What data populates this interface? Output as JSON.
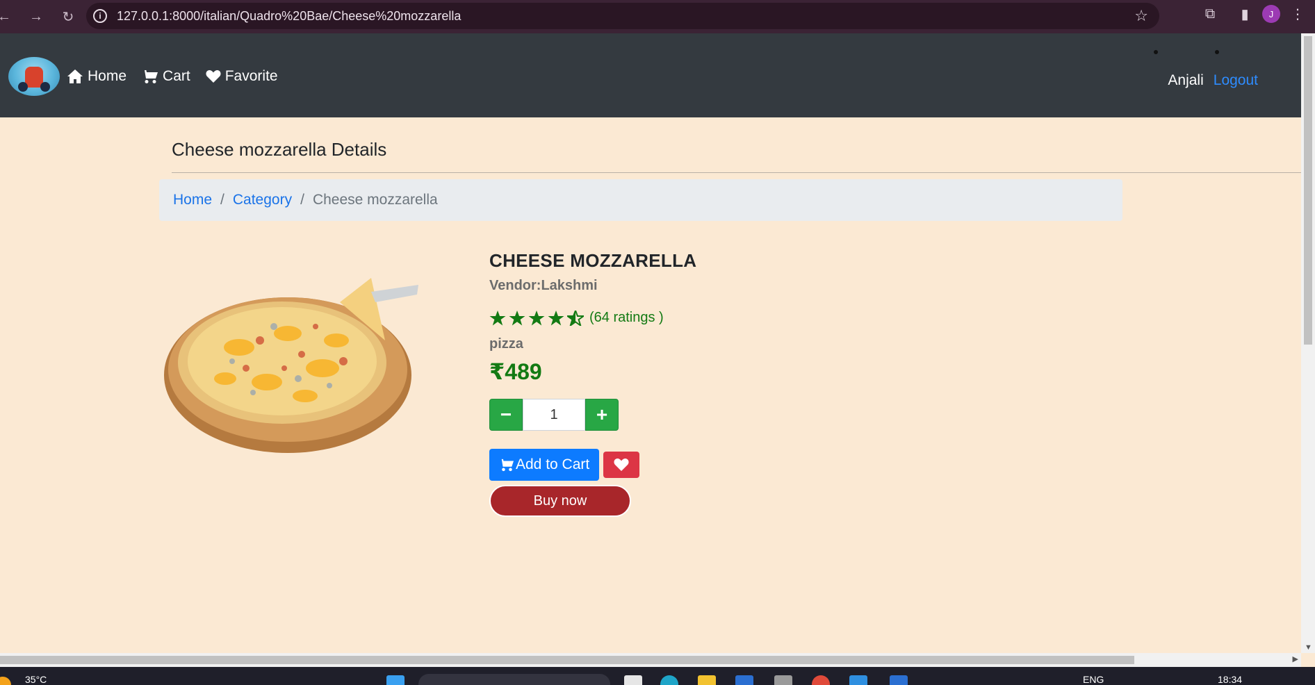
{
  "browser": {
    "url": "127.0.0.1:8000/italian/Quadro%20Bae/Cheese%20mozzarella",
    "profile_initial": "J"
  },
  "navbar": {
    "links": [
      {
        "label": "Home",
        "icon": "home-icon"
      },
      {
        "label": "Cart",
        "icon": "cart-icon"
      },
      {
        "label": "Favorite",
        "icon": "heart-icon"
      }
    ],
    "user_name": "Anjali",
    "logout_label": "Logout"
  },
  "page": {
    "title": "Cheese mozzarella Details",
    "breadcrumb": [
      "Home",
      "Category",
      "Cheese mozzarella"
    ]
  },
  "product": {
    "name": "CHEESE MOZZARELLA",
    "vendor": "Vendor:Lakshmi",
    "rating_stars": 4.5,
    "rating_text": "(64 ratings )",
    "category": "pizza",
    "price": "₹489",
    "quantity": "1",
    "add_to_cart_label": "Add to Cart",
    "buy_now_label": "Buy now"
  },
  "taskbar": {
    "temperature": "35°C",
    "language": "ENG",
    "time": "18:34"
  },
  "colors": {
    "page_bg": "#fbe9d3",
    "navbar_bg": "#343a40",
    "price_green": "#137a13",
    "primary_blue": "#0d7bff",
    "danger_red": "#dc3545",
    "buy_red": "#a8262a"
  }
}
